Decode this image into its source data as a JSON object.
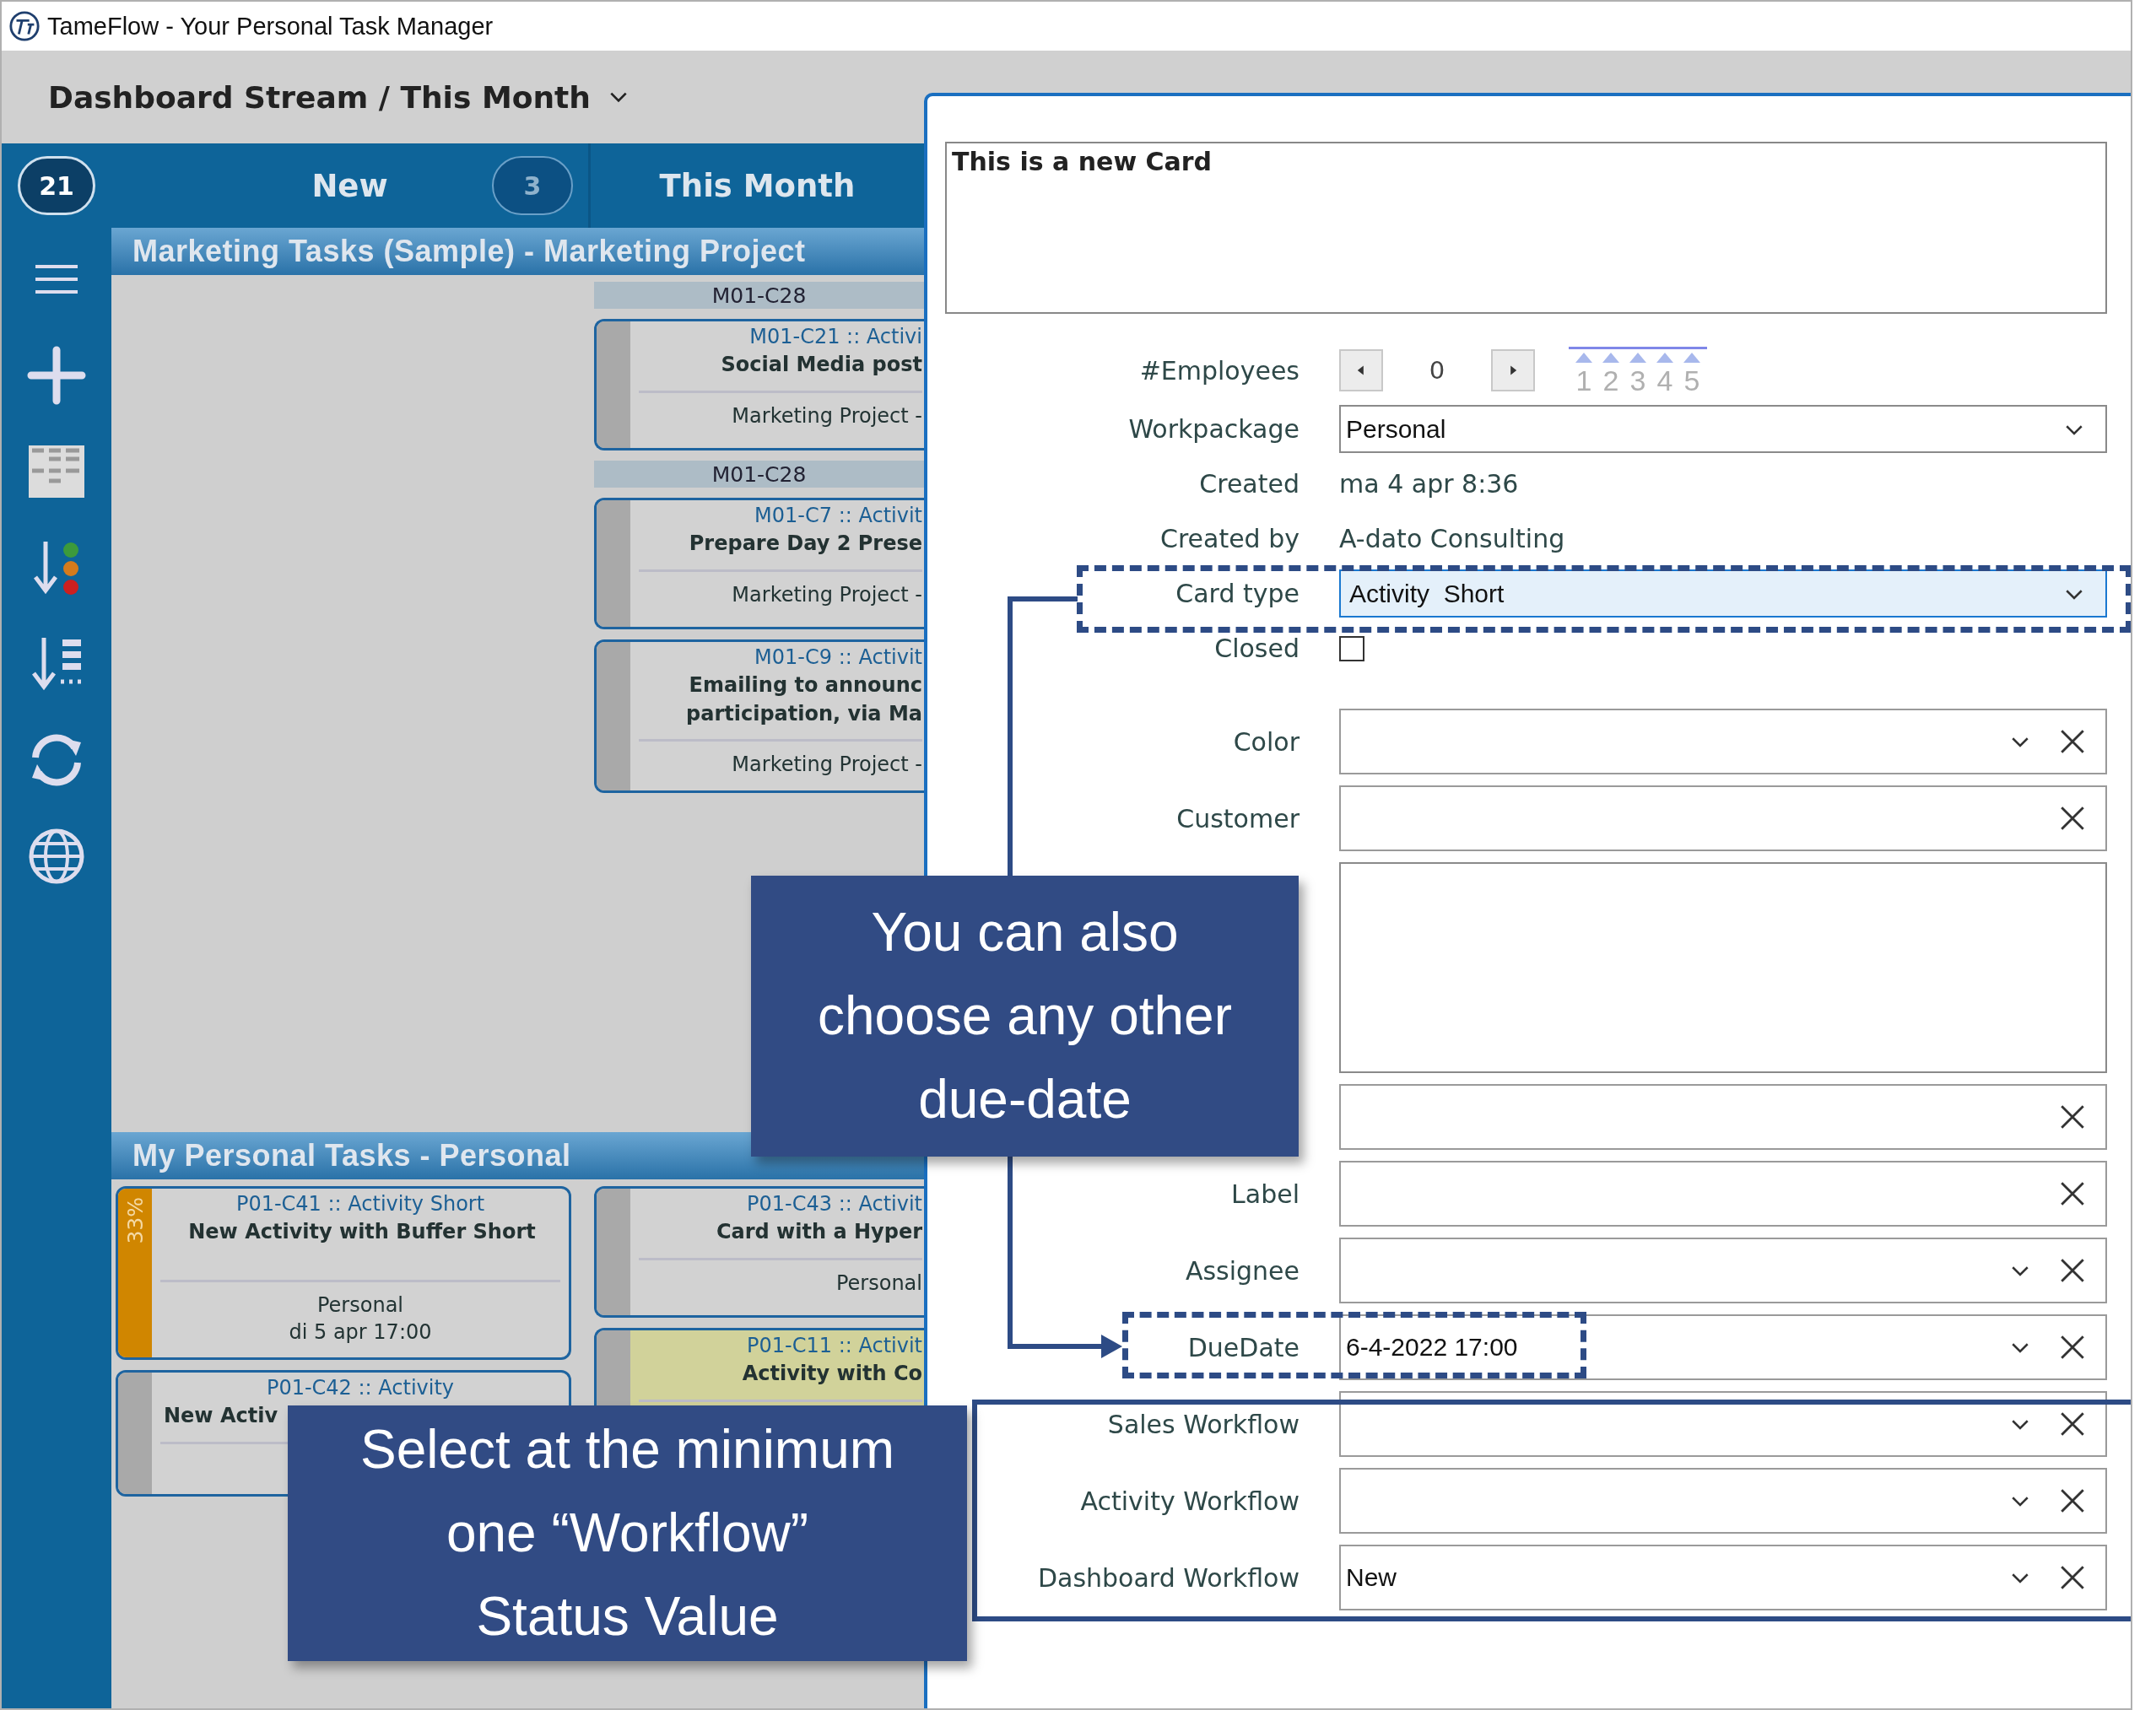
{
  "window": {
    "title": "TameFlow - Your Personal Task Manager"
  },
  "header": {
    "title": "Dashboard Stream / This Month"
  },
  "total_count": "21",
  "columns": [
    {
      "title": "New",
      "count": "3"
    },
    {
      "title": "This Month"
    }
  ],
  "lanes": [
    {
      "title": "Marketing Tasks (Sample) - Marketing Project",
      "this_month_items": [
        {
          "kind": "group",
          "label": "M01-C28"
        },
        {
          "kind": "card",
          "id_line": "M01-C21 :: Activi",
          "title": [
            "Social Media post"
          ],
          "details": [
            "Marketing Project  -"
          ],
          "color": "#a9a9a9",
          "highlighted": false
        },
        {
          "kind": "group",
          "label": "M01-C28"
        },
        {
          "kind": "card",
          "id_line": "M01-C7 :: Activit",
          "title": [
            "Prepare Day 2 Prese"
          ],
          "details": [
            "Marketing Project  -"
          ],
          "color": "#a9a9a9",
          "highlighted": false
        },
        {
          "kind": "card",
          "id_line": "M01-C9 :: Activit",
          "title": [
            "Emailing to announc",
            "participation, via Ma"
          ],
          "details": [
            "Marketing Project  -"
          ],
          "color": "#a9a9a9",
          "highlighted": false
        }
      ]
    },
    {
      "title": "My Personal Tasks - Personal",
      "new_items": [
        {
          "kind": "card",
          "id_line": "P01-C41 :: Activity  Short",
          "title": [
            "New Activity with Buffer Short"
          ],
          "details": [
            "Personal",
            "di 5 apr 17:00"
          ],
          "color": "#d08600",
          "progress": "33%",
          "highlighted": false
        },
        {
          "kind": "card",
          "id_line": "P01-C42 :: Activity",
          "title": [
            "New Activ"
          ],
          "color": "#a9a9a9",
          "highlighted": false
        }
      ],
      "this_month_items": [
        {
          "kind": "card",
          "id_line": "P01-C43 :: Activit",
          "title": [
            "Card with a Hyper"
          ],
          "details": [
            "Personal"
          ],
          "color": "#a9a9a9",
          "highlighted": false
        },
        {
          "kind": "card",
          "id_line": "P01-C11 :: Activit",
          "title": [
            "Activity with Co"
          ],
          "color": "#a9a9a9",
          "highlighted": true
        }
      ]
    }
  ],
  "card_form": {
    "title": "This is a new Card",
    "fields": [
      {
        "kind": "spinner",
        "label": "#Employees",
        "value": "0",
        "scale": [
          "1",
          "2",
          "3",
          "4",
          "5"
        ]
      },
      {
        "kind": "select",
        "label": "Workpackage",
        "value": "Personal",
        "focused": false,
        "clearable": false
      },
      {
        "kind": "info",
        "label": "Created",
        "value": "ma 4 apr 8:36"
      },
      {
        "kind": "info",
        "label": "Created by",
        "value": "A-dato Consulting"
      },
      {
        "kind": "select",
        "label": "Card type",
        "value": "Activity  Short",
        "focused": true,
        "clearable": false
      },
      {
        "kind": "checkbox",
        "label": "Closed",
        "checked": false
      },
      {
        "kind": "select",
        "label": "Color",
        "focused": false,
        "clearable": true
      },
      {
        "kind": "input",
        "label": "Customer",
        "clearable": true
      },
      {
        "kind": "textarea"
      },
      {
        "kind": "input",
        "clearable": true
      },
      {
        "kind": "input",
        "label": "Label",
        "clearable": true
      },
      {
        "kind": "select",
        "label": "Assignee",
        "focused": false,
        "clearable": true
      },
      {
        "kind": "select",
        "label": "DueDate",
        "value": "6-4-2022 17:00",
        "focused": false,
        "clearable": true
      },
      {
        "kind": "select",
        "label": "Sales Workflow",
        "focused": false,
        "clearable": true
      },
      {
        "kind": "select",
        "label": "Activity Workflow",
        "focused": false,
        "clearable": true
      },
      {
        "kind": "select",
        "label": "Dashboard Workflow",
        "value": "New",
        "focused": false,
        "clearable": true
      }
    ]
  },
  "callouts": [
    {
      "lines": [
        "You can also",
        "choose any other",
        "due-date"
      ]
    },
    {
      "lines": [
        "Select at the minimum",
        "one “Workflow”",
        "Status Value"
      ]
    }
  ]
}
